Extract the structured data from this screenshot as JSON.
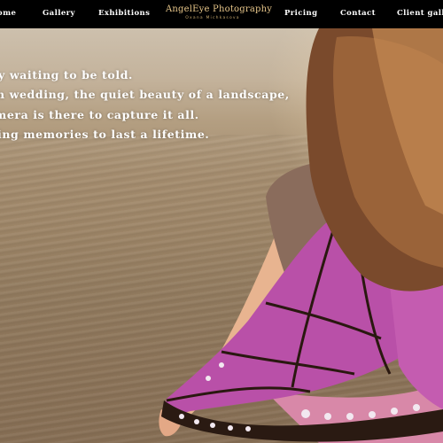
{
  "nav": {
    "home": "ome",
    "gallery": "Gallery",
    "exhibitions": "Exhibitions",
    "pricing": "Pricing",
    "contact": "Contact",
    "client_gallery": "Client galler"
  },
  "logo": {
    "title": "AngelEye Photography",
    "subtitle": "Oxana Michkasova"
  },
  "hero": {
    "lines": [
      "y waiting to be told.",
      "n wedding, the quiet beauty of a landscape,",
      "mera is there to capture it all.",
      "ing memories to last a lifetime."
    ]
  },
  "colors": {
    "navbar_bg": "#000000",
    "nav_text": "#ffffff",
    "logo_gold": "#e7c68a",
    "hero_text": "#ffffff"
  }
}
